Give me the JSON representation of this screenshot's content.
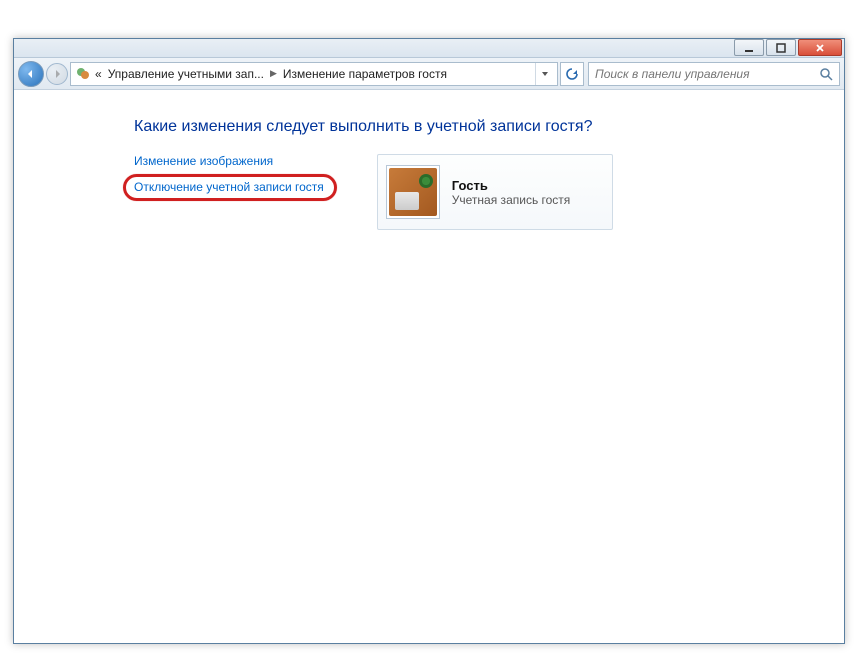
{
  "breadcrumb": {
    "prefix": "«",
    "part1": "Управление учетными зап...",
    "part2": "Изменение параметров гостя"
  },
  "search": {
    "placeholder": "Поиск в панели управления"
  },
  "page_title": "Какие изменения следует выполнить в учетной записи гостя?",
  "links": {
    "change_picture": "Изменение изображения",
    "turn_off_guest": "Отключение учетной записи гостя"
  },
  "account": {
    "name": "Гость",
    "type": "Учетная запись гостя"
  }
}
